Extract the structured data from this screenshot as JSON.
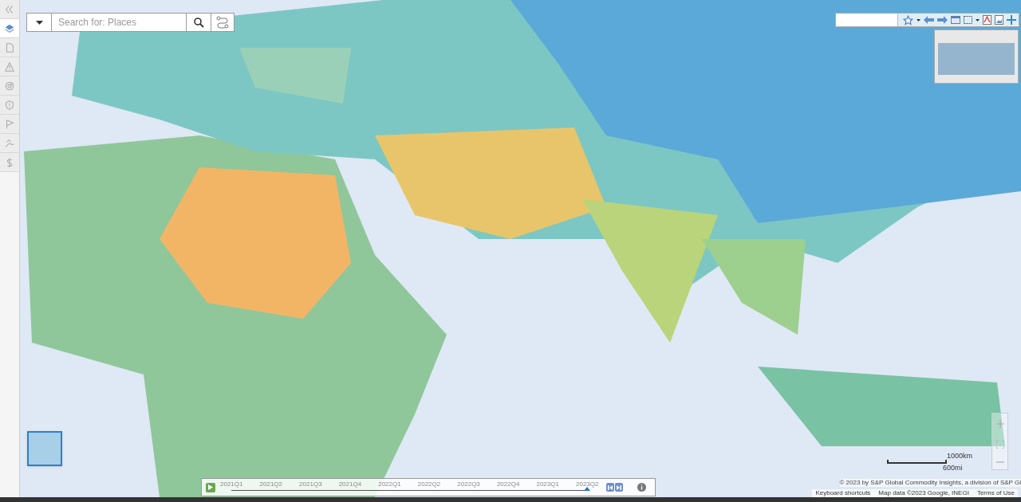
{
  "sidebar": {
    "items": [
      {
        "kind": "collapse",
        "selected": false
      },
      {
        "kind": "layers",
        "selected": true
      },
      {
        "kind": "document",
        "selected": false
      },
      {
        "kind": "warning",
        "selected": false
      },
      {
        "kind": "target",
        "selected": false
      },
      {
        "kind": "shield",
        "selected": false
      },
      {
        "kind": "flag",
        "selected": false
      },
      {
        "kind": "chart",
        "selected": false
      },
      {
        "kind": "dollar",
        "selected": false
      }
    ]
  },
  "search": {
    "placeholder": "Search for: Places"
  },
  "timeline": {
    "labels": [
      "2021Q1",
      "2021Q2",
      "2021Q3",
      "2021Q4",
      "2022Q1",
      "2022Q2",
      "2022Q3",
      "2022Q4",
      "2023Q1",
      "2023Q2"
    ],
    "level": 1
  },
  "scale": {
    "metric": "1000km",
    "imperial": "600mi"
  },
  "attribution": {
    "copyright": "© 2023 by S&P Global Commodity Insights, a division of S&P Gl",
    "links": [
      "Keyboard shortcuts",
      "Map data ©2023 Google, INEGI",
      "Terms of Use"
    ]
  }
}
